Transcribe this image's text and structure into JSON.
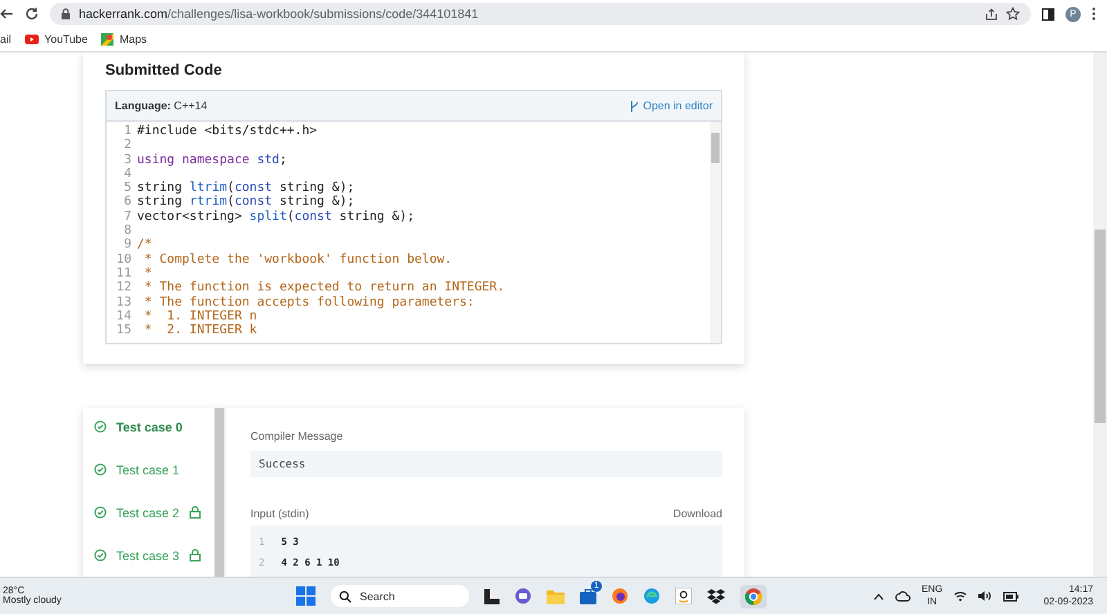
{
  "browser": {
    "url_host": "hackerrank.com",
    "url_path": "/challenges/lisa-workbook/submissions/code/344101841",
    "profile_initial": "P",
    "bookmarks": [
      {
        "kind": "mail",
        "label": "ail"
      },
      {
        "kind": "youtube",
        "label": "YouTube"
      },
      {
        "kind": "maps",
        "label": "Maps"
      }
    ]
  },
  "submitted_code": {
    "title": "Submitted Code",
    "language_label": "Language:",
    "language": "C++14",
    "open_in_editor": "Open in editor",
    "lines": [
      {
        "number": "1",
        "segments": [
          {
            "kind": "plain",
            "text": "#include <bits/stdc++.h>"
          }
        ]
      },
      {
        "number": "2"
      },
      {
        "number": "3",
        "segments": [
          {
            "kind": "keyword",
            "text": "using namespace "
          },
          {
            "kind": "type",
            "text": "std"
          },
          {
            "kind": "plain",
            "text": ";"
          }
        ]
      },
      {
        "number": "4"
      },
      {
        "number": "5",
        "segments": [
          {
            "kind": "plain",
            "text": "string "
          },
          {
            "kind": "function",
            "text": "ltrim"
          },
          {
            "kind": "plain",
            "text": "("
          },
          {
            "kind": "type",
            "text": "const"
          },
          {
            "kind": "plain",
            "text": " string &);"
          }
        ]
      },
      {
        "number": "6",
        "segments": [
          {
            "kind": "plain",
            "text": "string "
          },
          {
            "kind": "function",
            "text": "rtrim"
          },
          {
            "kind": "plain",
            "text": "("
          },
          {
            "kind": "type",
            "text": "const"
          },
          {
            "kind": "plain",
            "text": " string &);"
          }
        ]
      },
      {
        "number": "7",
        "segments": [
          {
            "kind": "plain",
            "text": "vector<string> "
          },
          {
            "kind": "function",
            "text": "split"
          },
          {
            "kind": "plain",
            "text": "("
          },
          {
            "kind": "type",
            "text": "const"
          },
          {
            "kind": "plain",
            "text": " string &);"
          }
        ]
      },
      {
        "number": "8"
      },
      {
        "number": "9",
        "segments": [
          {
            "kind": "comment",
            "text": "/*"
          }
        ]
      },
      {
        "number": "10",
        "segments": [
          {
            "kind": "comment",
            "text": " * Complete the 'workbook' function below."
          }
        ]
      },
      {
        "number": "11",
        "segments": [
          {
            "kind": "comment",
            "text": " *"
          }
        ]
      },
      {
        "number": "12",
        "segments": [
          {
            "kind": "comment",
            "text": " * The function is expected to return an INTEGER."
          }
        ]
      },
      {
        "number": "13",
        "segments": [
          {
            "kind": "comment",
            "text": " * The function accepts following parameters:"
          }
        ]
      },
      {
        "number": "14",
        "segments": [
          {
            "kind": "comment",
            "text": " *  1. INTEGER n"
          }
        ]
      },
      {
        "number": "15",
        "segments": [
          {
            "kind": "comment",
            "text": " *  2. INTEGER k"
          }
        ]
      }
    ]
  },
  "test_cases": [
    {
      "label": "Test case 0",
      "selected": true,
      "locked": false
    },
    {
      "label": "Test case 1",
      "selected": false,
      "locked": false
    },
    {
      "label": "Test case 2",
      "selected": false,
      "locked": true
    },
    {
      "label": "Test case 3",
      "selected": false,
      "locked": true
    }
  ],
  "result": {
    "compiler_message_label": "Compiler Message",
    "compiler_message": "Success",
    "input_label": "Input (stdin)",
    "download": "Download",
    "input_lines": [
      {
        "number": "1",
        "text": "5 3"
      },
      {
        "number": "2",
        "text": "4 2 6 1 10"
      }
    ]
  },
  "taskbar": {
    "temperature": "28°C",
    "weather": "Mostly cloudy",
    "search_placeholder": "Search",
    "store_badge": "1",
    "language": "ENG",
    "region": "IN",
    "time": "14:17",
    "date": "02-09-2023"
  }
}
